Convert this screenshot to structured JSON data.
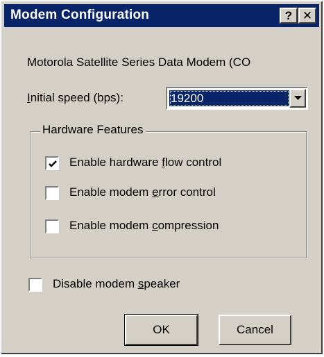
{
  "window": {
    "title": "Modem Configuration",
    "help_label": "?",
    "close_label": "✕"
  },
  "device_name": "Motorola Satellite Series Data Modem (CO",
  "speed": {
    "label_accel": "I",
    "label_rest": "nitial speed (bps):",
    "value": "19200"
  },
  "hardware_features": {
    "title": "Hardware Features",
    "options": [
      {
        "pre": "Enable hardware ",
        "accel": "f",
        "post": "low control",
        "checked": true
      },
      {
        "pre": "Enable modem ",
        "accel": "e",
        "post": "rror control",
        "checked": false
      },
      {
        "pre": "Enable modem ",
        "accel": "c",
        "post": "ompression",
        "checked": false
      }
    ]
  },
  "speaker": {
    "pre": "Disable modem ",
    "accel": "s",
    "post": "peaker",
    "checked": false
  },
  "buttons": {
    "ok": "OK",
    "cancel": "Cancel"
  }
}
